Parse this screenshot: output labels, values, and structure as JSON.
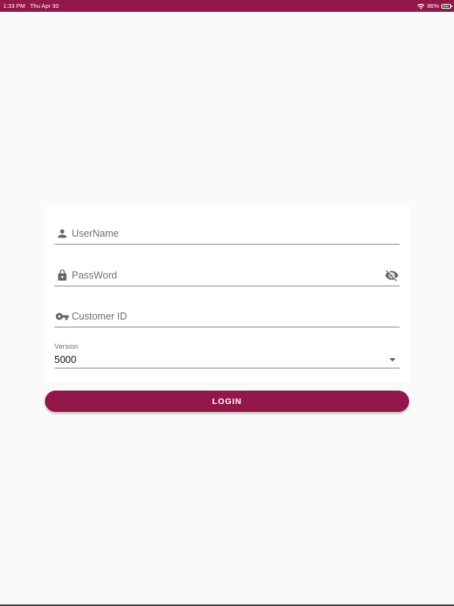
{
  "status_bar": {
    "time": "1:33 PM",
    "date": "Thu Apr 30",
    "battery": "86%",
    "icons": [
      "wifi-icon",
      "battery-icon"
    ]
  },
  "login_form": {
    "username_placeholder": "UserName",
    "password_placeholder": "PassWord",
    "customer_id_placeholder": "Customer ID",
    "version_label": "Version",
    "version_value": "5000",
    "login_label": "LOGIN",
    "icons": [
      "person-icon",
      "lock-icon",
      "visibility-off-icon",
      "key-icon",
      "dropdown-arrow-icon"
    ]
  },
  "colors": {
    "accent": "#93174a",
    "background": "#fafafa",
    "card": "#ffffff"
  }
}
